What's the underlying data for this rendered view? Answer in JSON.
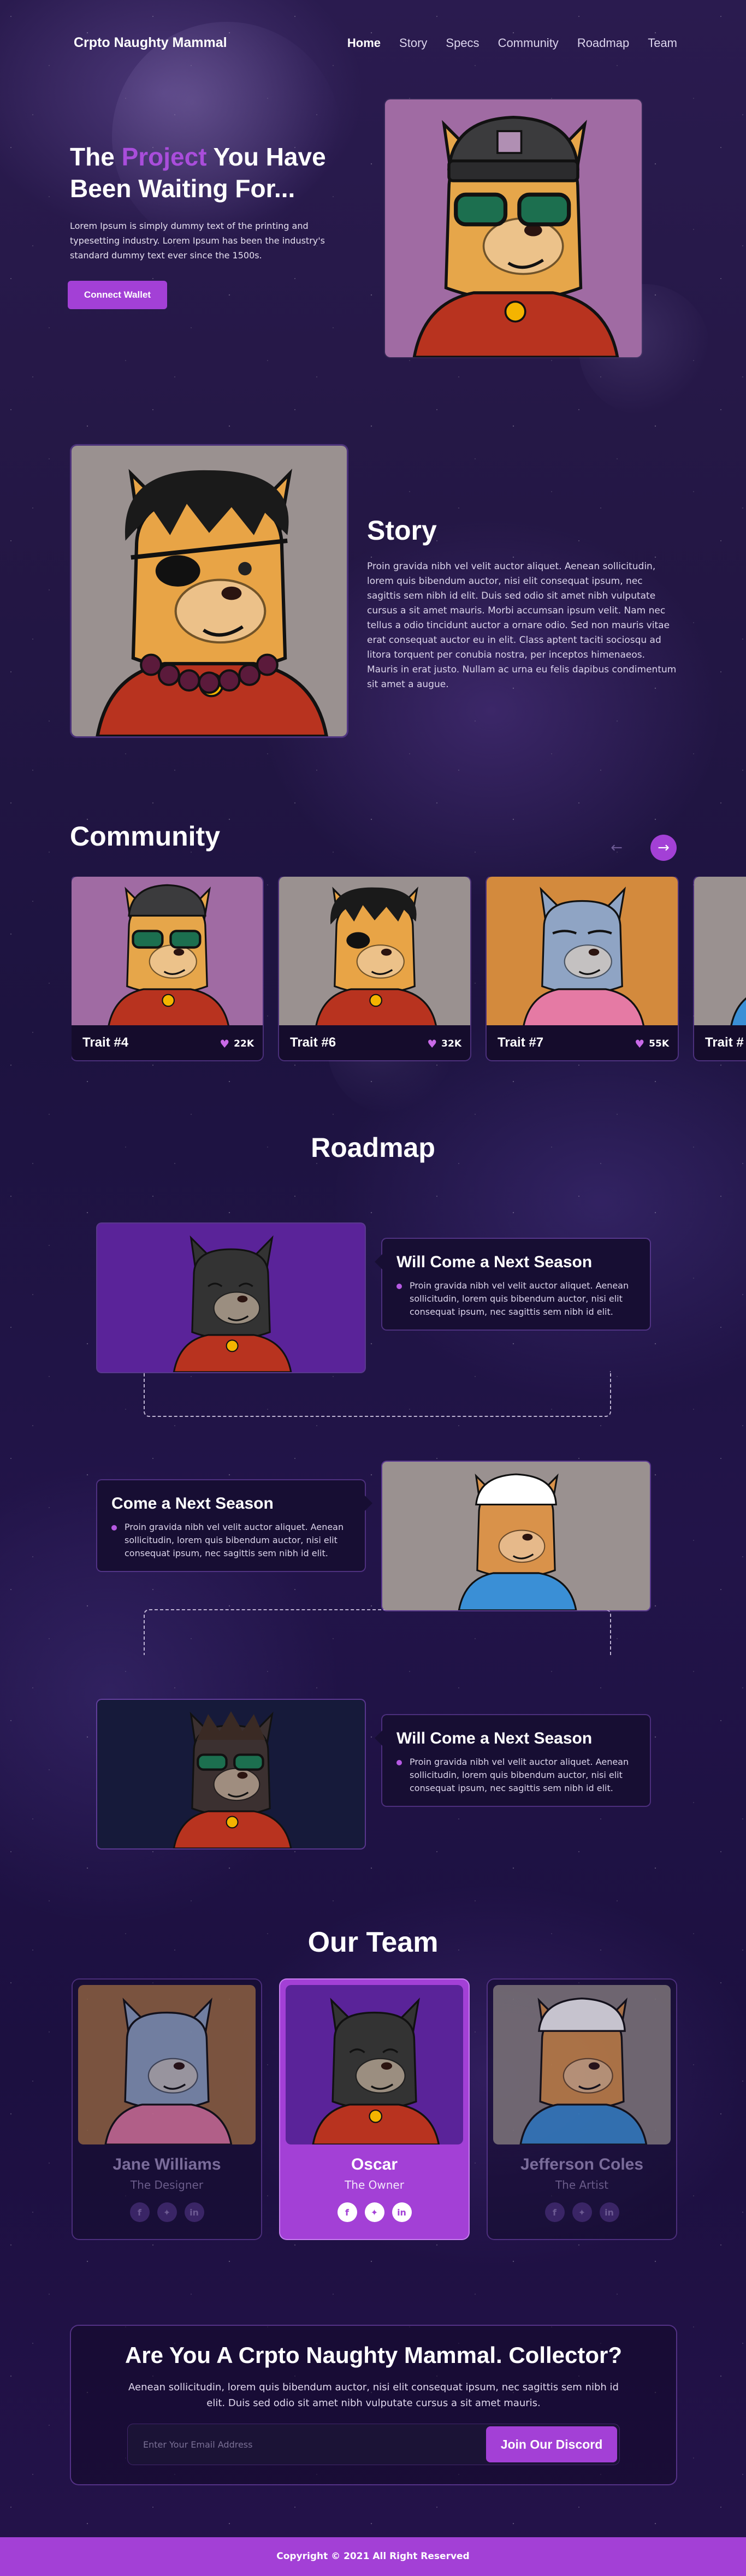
{
  "brand": "Crpto Naughty Mammal",
  "nav": [
    {
      "label": "Home",
      "active": true
    },
    {
      "label": "Story"
    },
    {
      "label": "Specs"
    },
    {
      "label": "Community"
    },
    {
      "label": "Roadmap"
    },
    {
      "label": "Team"
    }
  ],
  "hero": {
    "title_pre": "The ",
    "title_hl": "Project",
    "title_post": " You Have Been Waiting For...",
    "description": "Lorem Ipsum is simply dummy text of the printing and typesetting industry. Lorem Ipsum has been the industry's standard dummy text ever since the 1500s.",
    "button": "Connect Wallet"
  },
  "story": {
    "title": "Story",
    "text": "Proin gravida nibh vel velit auctor aliquet. Aenean sollicitudin, lorem quis bibendum auctor, nisi elit consequat ipsum, nec sagittis sem nibh id elit. Duis sed odio sit amet nibh vulputate cursus a sit amet mauris. Morbi accumsan ipsum velit. Nam nec tellus a odio tincidunt auctor a ornare odio. Sed non  mauris vitae erat consequat auctor eu in elit. Class aptent taciti sociosqu ad litora torquent per conubia nostra, per inceptos himenaeos. Mauris in erat justo. Nullam ac urna eu felis dapibus condimentum sit amet a augue."
  },
  "community": {
    "title": "Community",
    "prev_icon": "arrow-left-icon",
    "next_icon": "arrow-right-icon",
    "cards": [
      {
        "name": "Trait #4",
        "likes": "22K"
      },
      {
        "name": "Trait #6",
        "likes": "32K"
      },
      {
        "name": "Trait #7",
        "likes": "55K"
      },
      {
        "name": "Trait #"
      }
    ]
  },
  "roadmap": {
    "title": "Roadmap",
    "items": [
      {
        "title": "Will Come a Next Season",
        "text": "Proin gravida nibh vel velit auctor aliquet. Aenean sollicitudin, lorem quis bibendum auctor, nisi elit consequat ipsum, nec sagittis sem nibh id elit."
      },
      {
        "title": "Come a Next Season",
        "text": "Proin gravida nibh vel velit auctor aliquet. Aenean sollicitudin, lorem quis bibendum auctor, nisi elit consequat ipsum, nec sagittis sem nibh id elit."
      },
      {
        "title": "Will Come a Next Season",
        "text": "Proin gravida nibh vel velit auctor aliquet. Aenean sollicitudin, lorem quis bibendum auctor, nisi elit consequat ipsum, nec sagittis sem nibh id elit."
      }
    ]
  },
  "team": {
    "title": "Our Team",
    "members": [
      {
        "name": "Jane Williams",
        "role": "The Designer"
      },
      {
        "name": "Oscar",
        "role": "The Owner",
        "highlighted": true
      },
      {
        "name": "Jefferson Coles",
        "role": "The Artist"
      }
    ],
    "social_icons": [
      "facebook-icon",
      "twitter-icon",
      "linkedin-icon"
    ]
  },
  "cta": {
    "title": "Are You A  Crpto Naughty Mammal. Collector?",
    "text": "Aenean sollicitudin, lorem quis bibendum auctor, nisi elit consequat ipsum, nec sagittis sem nibh id elit. Duis sed odio sit amet nibh vulputate cursus a sit amet mauris.",
    "placeholder": "Enter Your Email Address",
    "button": "Join Our Discord"
  },
  "footer": "Copyright © 2021 All Right Reserved",
  "colors": {
    "accent": "#a340d6",
    "highlight": "#a94ddb"
  }
}
